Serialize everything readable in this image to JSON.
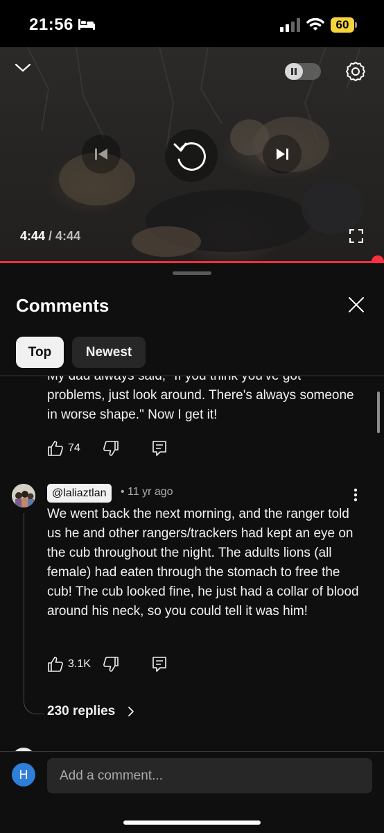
{
  "status_bar": {
    "time": "21:56",
    "battery": "60",
    "icons": [
      "bed-icon",
      "signal-icon",
      "wifi-icon"
    ]
  },
  "player": {
    "current_time": "4:44",
    "separator": " / ",
    "duration": "4:44",
    "progress": 1.0,
    "autoplay_on": false,
    "icons": [
      "chevron-down-icon",
      "pause-icon",
      "gear-icon",
      "skip-previous-icon",
      "replay-icon",
      "skip-next-icon",
      "fullscreen-icon"
    ]
  },
  "sheet": {
    "title": "Comments",
    "filters": [
      {
        "label": "Top",
        "selected": true
      },
      {
        "label": "Newest",
        "selected": false
      }
    ]
  },
  "comments": [
    {
      "text_cut": "My dad always said, \"If you think you've got",
      "text": "problems, just look around. There's always someone in worse shape.\" Now I get it!",
      "likes": "74"
    },
    {
      "author": "@laliaztlan",
      "time": "• 11 yr ago",
      "text": "We went back the next morning, and the ranger told us he and other rangers/trackers had kept an eye on the cub throughout the night. The adults lions (all female) had eaten through the stomach to free the cub! The cub looked fine, he just had a collar of blood around his neck, so you could tell it was him!",
      "likes": "3.1K",
      "replies": "230 replies"
    }
  ],
  "composer": {
    "avatar_letter": "H",
    "placeholder": "Add a comment..."
  },
  "colors": {
    "accent": "#ff2e3e",
    "background": "#0f0f0f",
    "avatar": "#2f7ed8",
    "battery": "#f5d33a"
  }
}
